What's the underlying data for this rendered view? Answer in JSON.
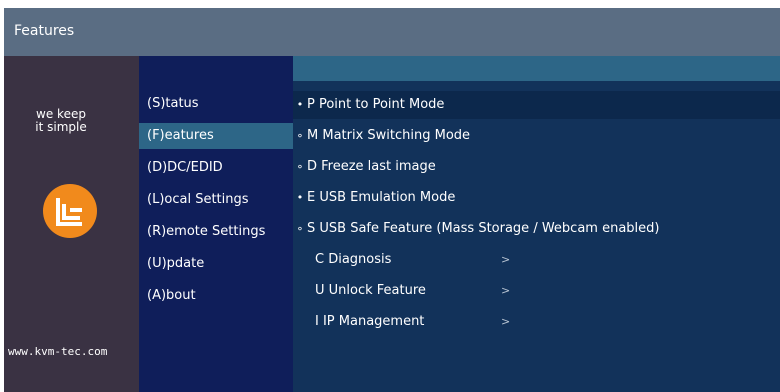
{
  "window": {
    "title": "Features"
  },
  "branding": {
    "tagline_line1": "we keep",
    "tagline_line2": "it simple",
    "logo": "kvm-tec-logo",
    "website": "www.kvm-tec.com",
    "colors": {
      "logo": "#f18a1c"
    }
  },
  "menu": {
    "items": [
      {
        "label": "(S)tatus"
      },
      {
        "label": "(F)eatures",
        "selected": true
      },
      {
        "label": "(D)DC/EDID"
      },
      {
        "label": "(L)ocal  Settings"
      },
      {
        "label": "(R)emote Settings"
      },
      {
        "label": "(U)pdate"
      },
      {
        "label": "(A)bout"
      }
    ]
  },
  "features": {
    "items": [
      {
        "bullet": "•",
        "label": "P Point to Point Mode"
      },
      {
        "bullet": "∘",
        "label": "M Matrix Switching Mode"
      },
      {
        "bullet": "∘",
        "label": "D Freeze last image"
      },
      {
        "bullet": "•",
        "label": "E USB Emulation Mode"
      },
      {
        "bullet": "∘",
        "label": "S USB Safe Feature (Mass Storage / Webcam enabled)"
      },
      {
        "label": "C Diagnosis",
        "chevron": ">"
      },
      {
        "label": "U Unlock Feature",
        "chevron": ">"
      },
      {
        "label": "I IP Management",
        "chevron": ">"
      }
    ]
  }
}
